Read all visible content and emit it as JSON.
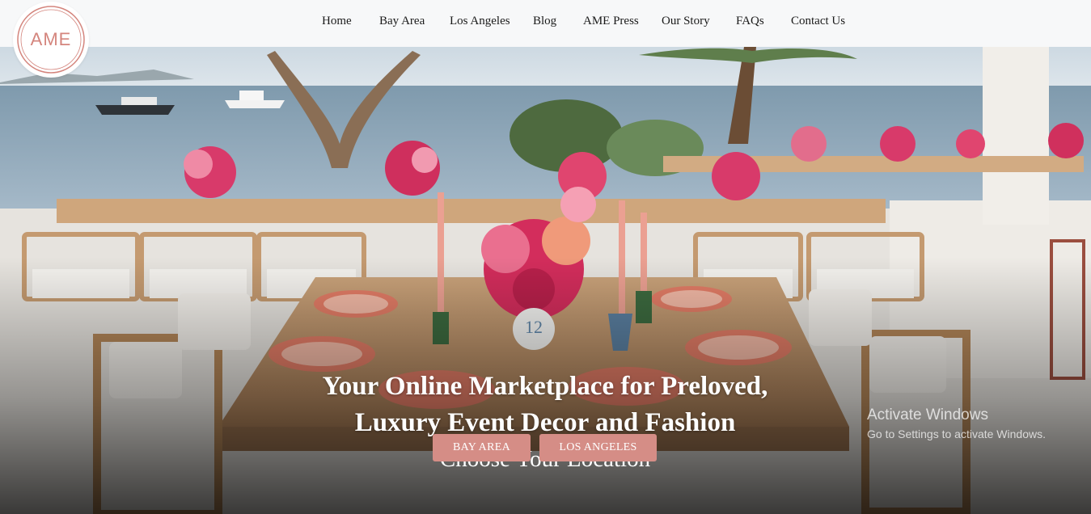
{
  "header": {
    "logo_text": "AME",
    "nav": [
      {
        "label": "Home"
      },
      {
        "label": "Bay Area"
      },
      {
        "label": "Los Angeles"
      },
      {
        "label": "Blog"
      },
      {
        "label": "AME Press"
      },
      {
        "label": "Our Story"
      },
      {
        "label": "FAQs"
      },
      {
        "label": "Contact Us"
      }
    ]
  },
  "hero": {
    "headline_line1": "Your Online Marketplace for Preloved,",
    "headline_line2": "Luxury Event Decor and Fashion",
    "subheading": "Choose Your Location",
    "buttons": {
      "bay_area": "BAY AREA",
      "los_angeles": "LOS ANGELES"
    },
    "table_number": "12"
  },
  "watermark": {
    "title": "Activate Windows",
    "subtitle": "Go to Settings to activate Windows."
  },
  "colors": {
    "accent": "#d58d86",
    "logo": "#d4857d",
    "header_bg": "#f7f8f9"
  }
}
